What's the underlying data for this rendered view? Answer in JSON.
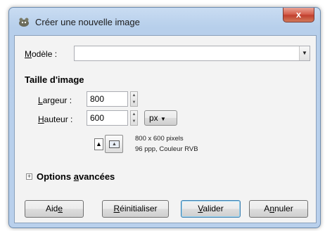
{
  "window": {
    "title": "Créer une nouvelle image",
    "close_label": "x"
  },
  "template": {
    "label": "Modèle :",
    "value": ""
  },
  "image_size": {
    "section_title": "Taille d'image",
    "width_label": "Largeur :",
    "width_value": "800",
    "height_label": "Hauteur :",
    "height_value": "600",
    "unit": "px"
  },
  "info": {
    "line1": "800 x 600 pixels",
    "line2": "96 ppp, Couleur RVB"
  },
  "advanced": {
    "label": "Options avancées",
    "expander": "+"
  },
  "buttons": {
    "help": "Aide",
    "reset": "Réinitialiser",
    "ok": "Valider",
    "cancel": "Annuler"
  }
}
